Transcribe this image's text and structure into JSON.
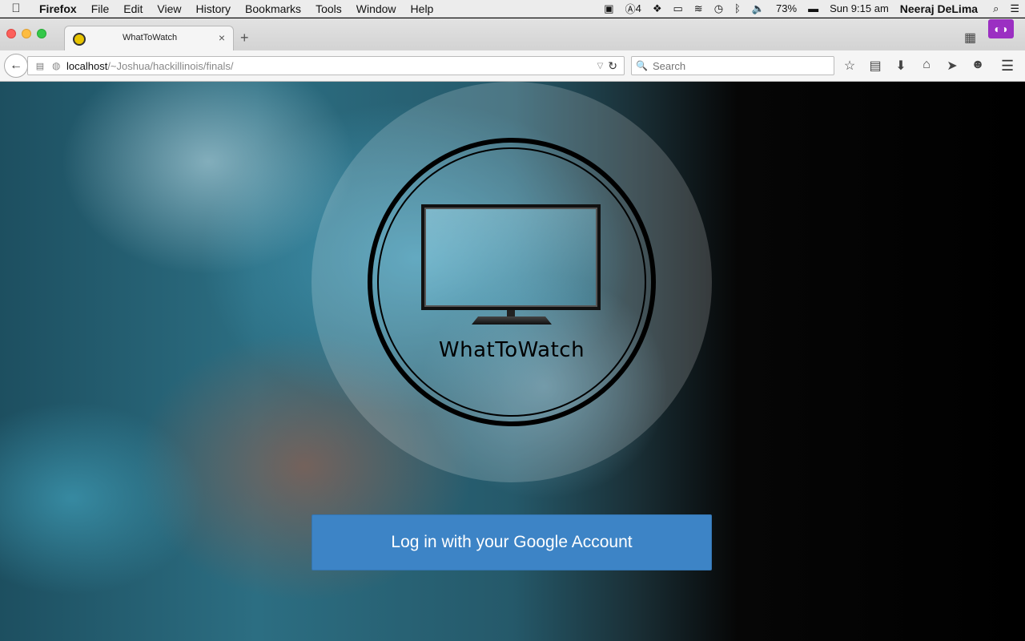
{
  "menubar": {
    "apple": "",
    "app_name": "Firefox",
    "items": [
      "File",
      "Edit",
      "View",
      "History",
      "Bookmarks",
      "Tools",
      "Window",
      "Help"
    ],
    "status": {
      "adobe_count": "4",
      "battery": "73%",
      "clock": "Sun 9:15 am",
      "user": "Neeraj DeLima"
    }
  },
  "tab": {
    "title": "WhatToWatch",
    "close": "×",
    "new_tab": "+"
  },
  "navbar": {
    "back": "←",
    "url_host": "localhost",
    "url_path": "/~Joshua/hackillinois/finals/",
    "search_placeholder": "Search"
  },
  "page": {
    "brand_name": "WhatToWatch",
    "login_button": "Log in with your Google Account"
  },
  "colors": {
    "login_button": "#3d84c6",
    "private_mask": "#9b2fc2"
  }
}
